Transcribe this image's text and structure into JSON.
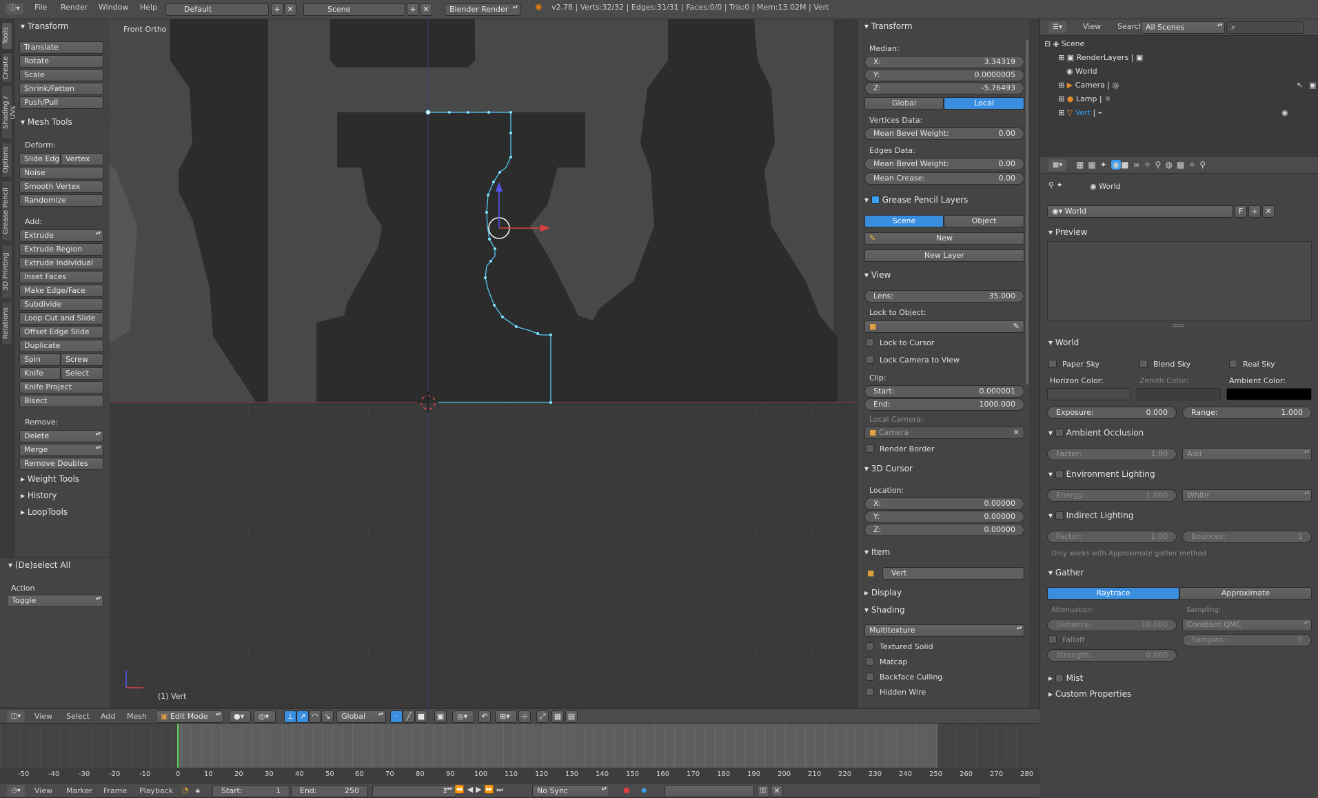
{
  "topbar": {
    "menus": [
      "File",
      "Render",
      "Window",
      "Help"
    ],
    "layout": "Default",
    "scene": "Scene",
    "engine": "Blender Render",
    "stats": "v2.78 | Verts:32/32 | Edges:31/31 | Faces:0/0 | Tris:0 | Mem:13.02M | Vert"
  },
  "left_tabs": [
    "Tools",
    "Create",
    "Shading / UVs",
    "Options",
    "Grease Pencil",
    "3D Printing",
    "Relations"
  ],
  "toolshelf": {
    "transform_title": "Transform",
    "transform": [
      "Translate",
      "Rotate",
      "Scale",
      "Shrink/Fatten",
      "Push/Pull"
    ],
    "mesh_tools_title": "Mesh Tools",
    "deform_label": "Deform:",
    "slide_edge": "Slide Edge",
    "vertex": "Vertex",
    "noise": "Noise",
    "smooth_vertex": "Smooth Vertex",
    "randomize": "Randomize",
    "add_label": "Add:",
    "extrude": "Extrude",
    "extrude_region": "Extrude Region",
    "extrude_individual": "Extrude Individual",
    "inset_faces": "Inset Faces",
    "make_edge_face": "Make Edge/Face",
    "subdivide": "Subdivide",
    "loop_cut": "Loop Cut and Slide",
    "offset_edge": "Offset Edge Slide",
    "duplicate": "Duplicate",
    "spin": "Spin",
    "screw": "Screw",
    "knife": "Knife",
    "select": "Select",
    "knife_project": "Knife Project",
    "bisect": "Bisect",
    "remove_label": "Remove:",
    "delete": "Delete",
    "merge": "Merge",
    "remove_doubles": "Remove Doubles",
    "weight_tools": "Weight Tools",
    "history": "History",
    "looptools": "LoopTools",
    "operator_title": "(De)select All",
    "action_label": "Action",
    "action_value": "Toggle"
  },
  "viewport": {
    "label": "Front Ortho",
    "object_label": "(1) Vert"
  },
  "properties_panel": {
    "transform_title": "Transform",
    "median_label": "Median:",
    "x_label": "X:",
    "x_value": "3.34319",
    "y_label": "Y:",
    "y_value": "0.0000005",
    "z_label": "Z:",
    "z_value": "-5.76493",
    "global": "Global",
    "local": "Local",
    "vertices_data": "Vertices Data:",
    "mean_bevel_weight": "Mean Bevel Weight:",
    "v_bevel_value": "0.00",
    "edges_data": "Edges Data:",
    "e_bevel_value": "0.00",
    "mean_crease": "Mean Crease:",
    "crease_value": "0.00",
    "gp_title": "Grease Pencil Layers",
    "gp_scene": "Scene",
    "gp_object": "Object",
    "gp_new": "New",
    "gp_new_layer": "New Layer",
    "view_title": "View",
    "lens_label": "Lens:",
    "lens_value": "35.000",
    "lock_object": "Lock to Object:",
    "lock_cursor": "Lock to Cursor",
    "lock_camera": "Lock Camera to View",
    "clip_label": "Clip:",
    "start_label": "Start:",
    "start_value": "0.000001",
    "end_label": "End:",
    "end_value": "1000.000",
    "local_camera": "Local Camera:",
    "camera": "Camera",
    "render_border": "Render Border",
    "cursor_title": "3D Cursor",
    "location_label": "Location:",
    "cx": "0.00000",
    "cy": "0.00000",
    "cz": "0.00000",
    "item_title": "Item",
    "item_name": "Vert",
    "display_title": "Display",
    "shading_title": "Shading",
    "shading_mode": "Multitexture",
    "textured_solid": "Textured Solid",
    "matcap": "Matcap",
    "backface": "Backface Culling",
    "hidden_wire": "Hidden Wire"
  },
  "outliner": {
    "menus": [
      "View",
      "Search"
    ],
    "scenes": "All Scenes",
    "items": [
      "Scene",
      "RenderLayers",
      "World",
      "Camera",
      "Lamp",
      "Vert"
    ]
  },
  "world_props": {
    "breadcrumb": "World",
    "world_name": "World",
    "f_label": "F",
    "preview": "Preview",
    "world_title": "World",
    "paper_sky": "Paper Sky",
    "blend_sky": "Blend Sky",
    "real_sky": "Real Sky",
    "horizon_color": "Horizon Color:",
    "zenith_color": "Zenith Color:",
    "ambient_color": "Ambient Color:",
    "exposure_label": "Exposure:",
    "exposure_value": "0.000",
    "range_label": "Range:",
    "range_value": "1.000",
    "ao_title": "Ambient Occlusion",
    "factor_label": "Factor:",
    "ao_factor": "1.00",
    "ao_mode": "Add",
    "env_title": "Environment Lighting",
    "energy_label": "Energy:",
    "energy_value": "1.000",
    "env_color": "White",
    "indirect_title": "Indirect Lighting",
    "ind_factor": "1.00",
    "bounces_label": "Bounces:",
    "bounces_value": "1",
    "approx_note": "Only works with Approximate gather method",
    "gather_title": "Gather",
    "raytrace": "Raytrace",
    "approximate": "Approximate",
    "attenuation": "Attenuation:",
    "sampling": "Sampling:",
    "distance_label": "Distance:",
    "distance_value": "10.000",
    "sampling_value": "Constant QMC",
    "falloff": "Falloff",
    "samples_label": "Samples:",
    "samples_value": "5",
    "strength_label": "Strength:",
    "strength_value": "0.000",
    "mist": "Mist",
    "custom_props": "Custom Properties"
  },
  "view3d_header": {
    "menus": [
      "View",
      "Select",
      "Add",
      "Mesh"
    ],
    "mode": "Edit Mode",
    "orientation": "Global"
  },
  "timeline": {
    "ticks": [
      "-50",
      "-40",
      "-30",
      "-20",
      "-10",
      "0",
      "10",
      "20",
      "30",
      "40",
      "50",
      "60",
      "70",
      "80",
      "90",
      "100",
      "110",
      "120",
      "130",
      "140",
      "150",
      "160",
      "170",
      "180",
      "190",
      "200",
      "210",
      "220",
      "230",
      "240",
      "250",
      "260",
      "270",
      "280"
    ],
    "menus": [
      "View",
      "Marker",
      "Frame",
      "Playback"
    ],
    "start_label": "Start:",
    "start_value": "1",
    "end_label": "End:",
    "end_value": "250",
    "current": "1",
    "sync": "No Sync"
  },
  "colors": {
    "accent": "#3a9ff0",
    "selected_edge": "#58c8f5",
    "bg": "#3d3d3d",
    "viewport": "#393939"
  }
}
